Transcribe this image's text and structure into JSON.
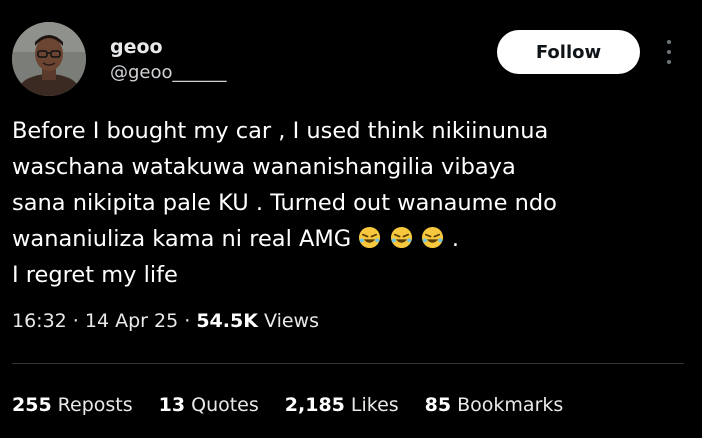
{
  "user": {
    "name": "geoo",
    "handle": "@geoo______"
  },
  "actions": {
    "follow_label": "Follow",
    "more_icon": "more-vertical-icon"
  },
  "tweet": {
    "lines": [
      "Before I bought my car , I used think nikiinunua",
      "waschana watakuwa wananishangilia vibaya",
      "sana  nikipita pale KU . Turned out  wanaume ndo",
      "wananiuliza kama ni real AMG",
      "I regret my life"
    ],
    "line4_suffix": ".",
    "emoji_icon": "rolling-on-floor-laughing-emoji"
  },
  "meta": {
    "time": "16:32",
    "sep1": " · ",
    "date": "14 Apr 25",
    "sep2": " · ",
    "views_count": "54.5K",
    "views_label": "Views"
  },
  "stats": [
    {
      "count": "255",
      "label": "Reposts"
    },
    {
      "count": "13",
      "label": "Quotes"
    },
    {
      "count": "2,185",
      "label": "Likes"
    },
    {
      "count": "85",
      "label": "Bookmarks"
    }
  ],
  "colors": {
    "background": "#000000",
    "text": "#e7e9ea",
    "follow_bg": "#ffffff",
    "divider": "#2f3336"
  }
}
